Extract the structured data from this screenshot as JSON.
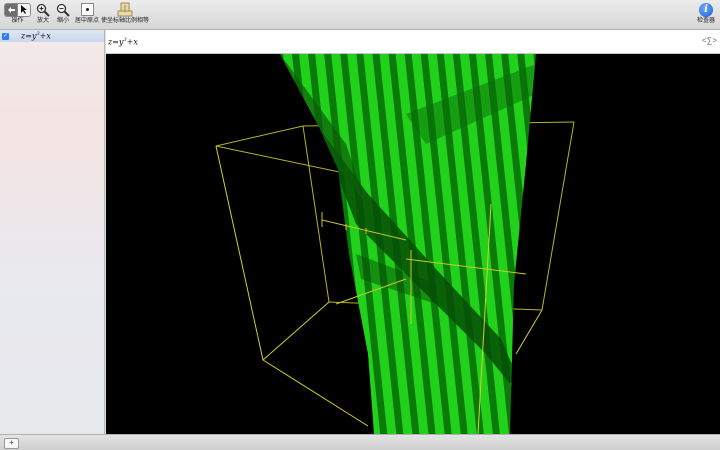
{
  "toolbar": {
    "operate_label": "操作",
    "zoom_in_label": "放大",
    "zoom_out_label": "缩小",
    "center_origin_label": "居中原点",
    "equal_axes_label": "使坐标轴比例相等",
    "inspector_label": "检查器"
  },
  "sidebar": {
    "equation": "z=y³+x",
    "checked": true
  },
  "formula_bar": {
    "equation": "z=y³+x",
    "menu_glyph": "<∑>"
  },
  "bottom_bar": {
    "add_glyph": "+"
  },
  "plot": {
    "surface_color": "#22d11c",
    "surface_dark": "#0a7a08",
    "box_color": "#c9c92a",
    "background": "#000000"
  }
}
